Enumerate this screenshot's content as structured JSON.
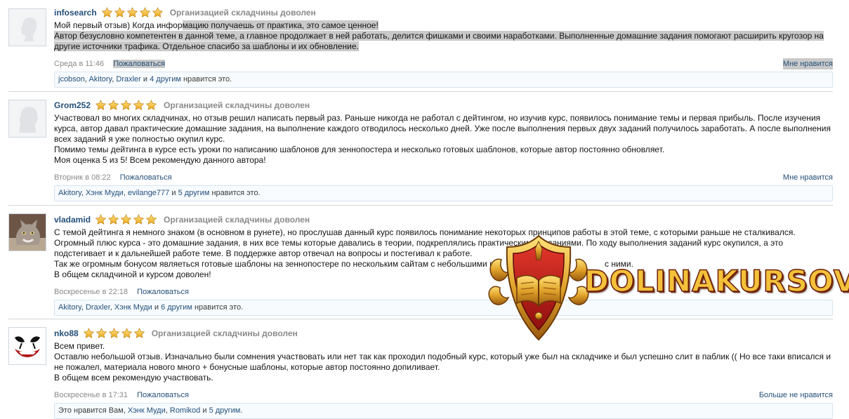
{
  "colors": {
    "link": "#24507a",
    "muted": "#8a8a8a",
    "star": "#f4c53d",
    "highlight": "#c9c9c9"
  },
  "reviews": [
    {
      "username": "infosearch",
      "rating_text": "Организацией складчины доволен",
      "stars": 5,
      "lines": [
        "Мой первый отзыв) Когда инфор",
        "мацию получаешь от практика, это самое ценное!",
        "Автор безусловно компетентен в данной теме, а главное продолжает в ней работать, делится фишками и своими наработками. Выполненные домашние задания помогают расширить кругозор на",
        "другие источники трафика. Отдельное спасибо за шаблоны и их обновление."
      ],
      "date": "Среда в 11:46",
      "report": "Пожаловаться",
      "like": "Мне нравится",
      "likes_users": [
        "jcobson",
        "Akitory",
        "Draxler"
      ],
      "likes_and": "и",
      "likes_others": "4 другим",
      "likes_suffix": "нравится это."
    },
    {
      "username": "Grom252",
      "rating_text": "Организацией складчины доволен",
      "stars": 5,
      "lines": [
        "Участвовал во многих складчинах, но отзыв решил написать первый раз. Раньше никогда не работал с дейтингом, но изучив курс, появилось понимание темы и первая прибыль. После изучения",
        "курса, автор давал практические домашние задания, на выполнение каждого отводилось несколько дней. Уже после выполнения первых двух заданий получилось заработать. А после выполнения",
        "всех заданий я уже полностью окупил курс.",
        "Помимо темы дейтинга в курсе есть уроки по написанию шаблонов для зеннопостера и несколько готовых шаблонов, которые автор постоянно обновляет.",
        "Моя оценка 5 из 5! Всем рекомендую данного автора!"
      ],
      "date": "Вторник в 08:22",
      "report": "Пожаловаться",
      "like": "Мне нравится",
      "likes_users": [
        "Akitory",
        "Хэнк Муди",
        "evilange777"
      ],
      "likes_and": "и",
      "likes_others": "5 другим",
      "likes_suffix": "нравится это."
    },
    {
      "username": "vladamid",
      "rating_text": "Организацией складчины доволен",
      "stars": 5,
      "lines": [
        "С темой дейтинга я немного знаком (в основном в рунете), но прослушав данный курс появилось понимание некоторых принципов работы в этой теме, с которыми раньше не сталкивался.",
        "Огромный плюс курса - это домашние задания, в них все темы которые давались в теории, подкреплялись практическими заданиями. По ходу выполнения заданий курс окупился, а это",
        "подстегивает и к дальнейшей работе теме. В поддержке автор отвечал на вопросы и постегивал к работе.",
        "Так же огромным бонусом являеться готовые шаблоны на зеннопостере по нескольким сайтам с небольшими ви",
        "В общем складчиной и курсом доволен!"
      ],
      "line_tail": "с ними.",
      "date": "Воскресенье в 22:18",
      "report": "Пожаловаться",
      "like": "",
      "likes_users": [
        "Akitory",
        "Draxler",
        "Хэнк Муди"
      ],
      "likes_and": "и",
      "likes_others": "6 другим",
      "likes_suffix": "нравится это."
    },
    {
      "username": "nko88",
      "rating_text": "Организацией складчины доволен",
      "stars": 5,
      "lines": [
        "Всем привет.",
        "Оставлю небольшой отзыв. Изначально были сомнения участвовать или нет так как проходил подобный курс, который уже был на складчике и был успешно слит в паблик (( Но все таки вписался и",
        "не пожалел, материала нового много + бонусные шаблоны, которые автор постоянно допиливает.",
        "В общем всем рекомендую участвовать."
      ],
      "date": "Воскресенье в 17:31",
      "report": "Пожаловаться",
      "like": "Больше не нравится",
      "likes_prefix": "Это нравится Вам,",
      "likes_users": [
        "Хэнк Муди",
        "Romikod"
      ],
      "likes_and": "и",
      "likes_others": "5 другим",
      "likes_suffix": "."
    }
  ],
  "watermark": {
    "text": "DOLINAKURSOV"
  }
}
